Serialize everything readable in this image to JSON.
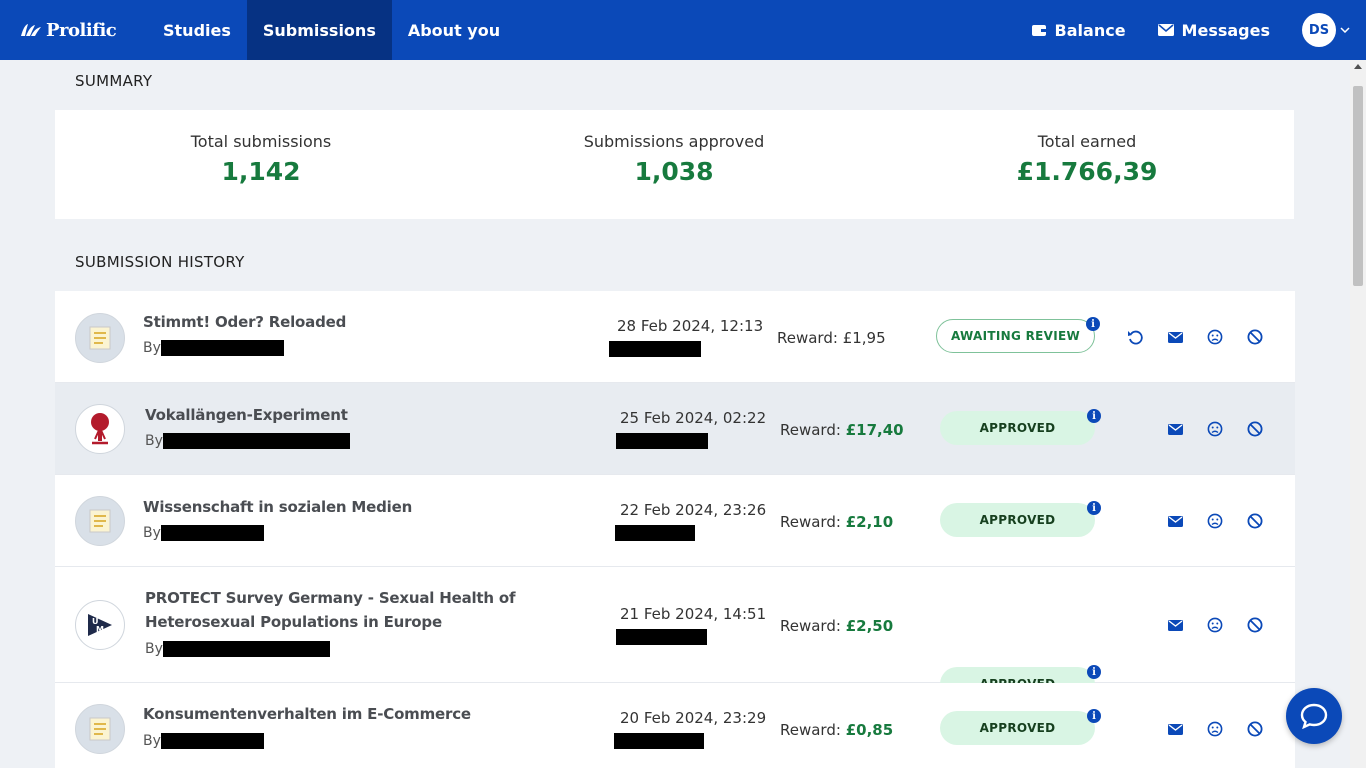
{
  "nav": {
    "logo": "Prolific",
    "links": [
      "Studies",
      "Submissions",
      "About you"
    ],
    "active": "Submissions",
    "balance_label": "Balance",
    "messages_label": "Messages",
    "avatar_initials": "DS"
  },
  "summary": {
    "title": "SUMMARY",
    "total_submissions_label": "Total submissions",
    "total_submissions_value": "1,142",
    "approved_label": "Submissions approved",
    "approved_value": "1,038",
    "earned_label": "Total earned",
    "earned_value": "£1.766,39"
  },
  "history": {
    "title": "SUBMISSION HISTORY",
    "by_label": "By",
    "reward_label": "Reward:",
    "rows": [
      {
        "title": "Stimmt! Oder? Reloaded",
        "date": "28 Feb 2024, 12:13",
        "reward": "£1,95",
        "status": "AWAITING REVIEW"
      },
      {
        "title": "Vokallängen-Experiment",
        "date": "25 Feb 2024, 02:22",
        "reward": "£17,40",
        "status": "APPROVED"
      },
      {
        "title": "Wissenschaft in sozialen Medien",
        "date": "22 Feb 2024, 23:26",
        "reward": "£2,10",
        "status": "APPROVED"
      },
      {
        "title": "PROTECT Survey Germany - Sexual Health of Heterosexual Populations in Europe",
        "date": "21 Feb 2024, 14:51",
        "reward": "£2,50",
        "status": "APPROVED"
      },
      {
        "title": "Konsumentenverhalten im E-Commerce",
        "date": "20 Feb 2024, 23:29",
        "reward": "£0,85",
        "status": "APPROVED"
      }
    ]
  },
  "colors": {
    "nav": "#0b49b8",
    "nav_active": "#063283",
    "accent_green": "#177a3e",
    "approved_bg": "#d9f5e4"
  },
  "icons": [
    "wallet-icon",
    "mail-icon",
    "chevron-down-icon",
    "undo-icon",
    "message-icon",
    "sad-face-icon",
    "block-icon",
    "info-icon",
    "chat-icon",
    "document-icon"
  ]
}
